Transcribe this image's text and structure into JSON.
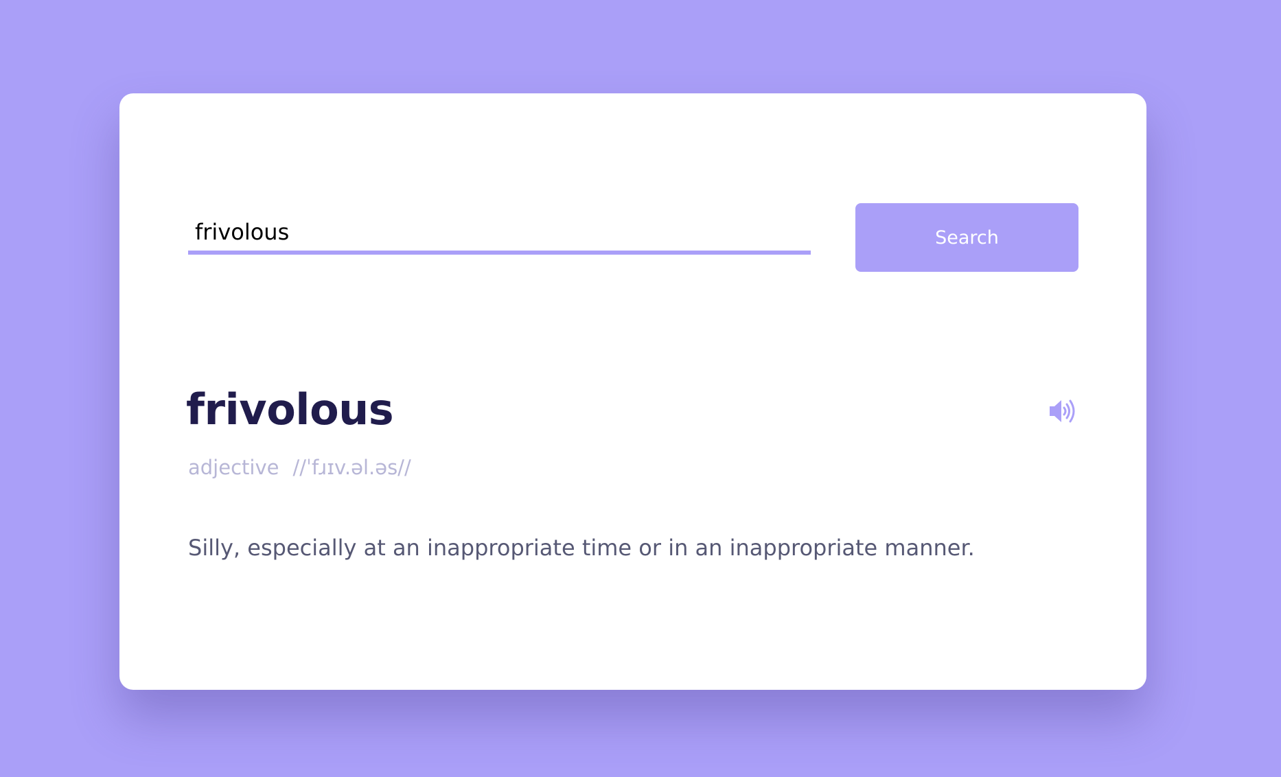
{
  "search": {
    "value": "frivolous",
    "button_label": "Search"
  },
  "entry": {
    "word": "frivolous",
    "part_of_speech": "adjective",
    "phonetic": "//ˈfɹɪv.əl.əs//",
    "definition": "Silly, especially at an inappropriate time or in an inappropriate manner."
  },
  "icons": {
    "pronunciation": "speaker-icon"
  },
  "colors": {
    "background": "#aa9ff8",
    "accent": "#aa9ff8",
    "card": "#ffffff",
    "word": "#201c4c",
    "muted": "#b7b6d6",
    "definition": "#565874"
  }
}
